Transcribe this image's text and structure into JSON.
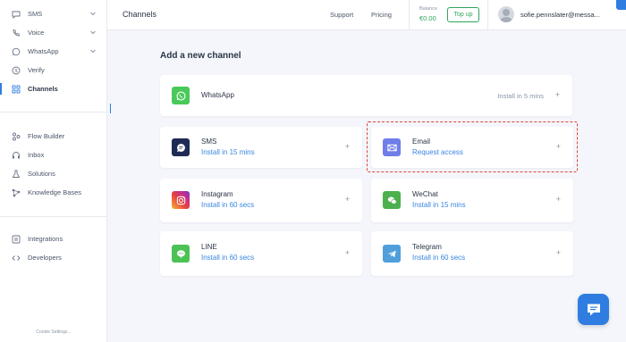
{
  "sidebar": {
    "items": [
      {
        "label": "SMS",
        "icon": "chat-bubble-icon"
      },
      {
        "label": "Voice",
        "icon": "phone-icon"
      },
      {
        "label": "WhatsApp",
        "icon": "whatsapp-icon"
      },
      {
        "label": "Verify",
        "icon": "dollar-icon"
      },
      {
        "label": "Channels",
        "icon": "grid-icon"
      },
      {
        "label": "Flow Builder",
        "icon": "flow-icon"
      },
      {
        "label": "Inbox",
        "icon": "headset-icon"
      },
      {
        "label": "Solutions",
        "icon": "flask-icon"
      },
      {
        "label": "Knowledge Bases",
        "icon": "nodes-icon"
      },
      {
        "label": "Integrations",
        "icon": "integration-icon"
      },
      {
        "label": "Developers",
        "icon": "code-icon"
      }
    ],
    "cookie_label": "Cookie Settings..."
  },
  "header": {
    "title": "Channels",
    "support": "Support",
    "pricing": "Pricing",
    "balance_label": "Balance",
    "balance_value": "€0.00",
    "topup": "Top up",
    "user_email": "sofie.pennslater@messa..."
  },
  "main": {
    "section_title": "Add a new channel",
    "whatsapp": {
      "name": "WhatsApp",
      "right": "Install in 5 mins",
      "plus": "+"
    },
    "channels": [
      {
        "name": "SMS",
        "sub": "Install in 15 mins",
        "plus": "+"
      },
      {
        "name": "Email",
        "sub": "Request access",
        "plus": "+"
      },
      {
        "name": "Instagram",
        "sub": "Install in 60 secs",
        "plus": "+"
      },
      {
        "name": "WeChat",
        "sub": "Install in 15 mins",
        "plus": "+"
      },
      {
        "name": "LINE",
        "sub": "Install in 60 secs",
        "plus": "+"
      },
      {
        "name": "Telegram",
        "sub": "Install in 60 secs",
        "plus": "+"
      }
    ]
  },
  "colors": {
    "accent": "#2f7de1",
    "balance_green": "#2fa65d",
    "highlight_red": "#e0443a",
    "whatsapp": "#4ac95b",
    "sms": "#1d2b55",
    "email": "#6f7ee8",
    "wechat": "#4cb04c",
    "line": "#4cc255",
    "telegram": "#4f9fdb"
  }
}
